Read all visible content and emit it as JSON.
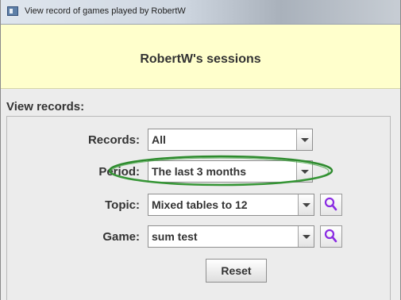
{
  "window": {
    "title": "View record of games played by RobertW"
  },
  "header": {
    "title": "RobertW's sessions"
  },
  "view_records": {
    "section_label": "View records:",
    "records": {
      "label": "Records:",
      "value": "All"
    },
    "period": {
      "label": "Period:",
      "value": "The last 3 months"
    },
    "topic": {
      "label": "Topic:",
      "value": "Mixed tables to 12"
    },
    "game": {
      "label": "Game:",
      "value": "sum test"
    },
    "reset_label": "Reset"
  },
  "colors": {
    "header_bg": "#ffffcc",
    "highlight": "#2e8b2e",
    "search_icon": "#8a2be2"
  },
  "icons": {
    "combo_arrow": "chevron-down-icon",
    "search": "search-icon",
    "window": "window-icon"
  }
}
